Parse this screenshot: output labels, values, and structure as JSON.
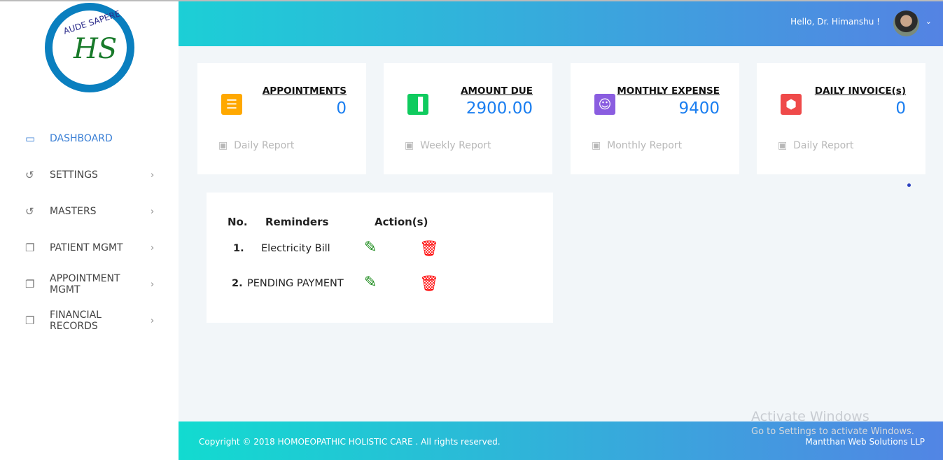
{
  "logo": {
    "text": "AUDE SAPERE",
    "monogram": "HS"
  },
  "sidebar": {
    "items": [
      {
        "label": "DASHBOARD",
        "icon": "monitor-icon",
        "active": true,
        "chevron": false
      },
      {
        "label": "SETTINGS",
        "icon": "refresh-icon",
        "chevron": true
      },
      {
        "label": "MASTERS",
        "icon": "refresh-icon",
        "chevron": true
      },
      {
        "label": "PATIENT MGMT",
        "icon": "copy-icon",
        "chevron": true
      },
      {
        "label": "APPOINTMENT MGMT",
        "icon": "copy-icon",
        "chevron": true
      },
      {
        "label": "FINANCIAL RECORDS",
        "icon": "copy-icon",
        "chevron": true
      }
    ]
  },
  "header": {
    "greeting": "Hello, Dr. Himanshu !"
  },
  "cards": [
    {
      "title": "APPOINTMENTS",
      "value": "0",
      "footer": "Daily Report",
      "icon": "receipt-icon",
      "color": "#ffa800"
    },
    {
      "title": "AMOUNT DUE",
      "value": "2900.00",
      "footer": "Weekly Report",
      "icon": "bar-chart-icon",
      "color": "#0fcb5e"
    },
    {
      "title": "MONTHLY EXPENSE",
      "value": "9400",
      "footer": "Monthly Report",
      "icon": "user-badge-icon",
      "color": "#8a5de0"
    },
    {
      "title": "DAILY INVOICE(s)",
      "value": "0",
      "footer": "Daily Report",
      "icon": "cube-icon",
      "color": "#ef4a4a"
    }
  ],
  "reminders": {
    "headers": [
      "No.",
      "Reminders",
      "Action(s)"
    ],
    "rows": [
      {
        "no": "1.",
        "text": "Electricity Bill"
      },
      {
        "no": "2.",
        "text": "PENDING PAYMENT"
      }
    ]
  },
  "footer": {
    "copyright": "Copyright © 2018 HOMOEOPATHIC HOLISTIC CARE . All rights reserved.",
    "company": "Mantthan Web Solutions LLP"
  },
  "watermark": {
    "title": "Activate Windows",
    "subtitle": "Go to Settings to activate Windows."
  }
}
